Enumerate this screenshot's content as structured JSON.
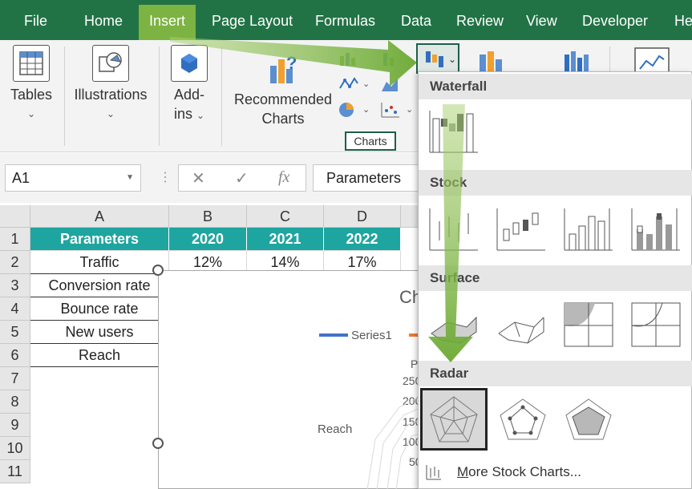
{
  "ribbon_tabs": [
    {
      "label": "File"
    },
    {
      "label": "Home"
    },
    {
      "label": "Insert",
      "active": true
    },
    {
      "label": "Page Layout"
    },
    {
      "label": "Formulas"
    },
    {
      "label": "Data"
    },
    {
      "label": "Review"
    },
    {
      "label": "View"
    },
    {
      "label": "Developer"
    },
    {
      "label": "Hel"
    }
  ],
  "ribbon": {
    "tables_label": "Tables",
    "illustrations_label": "Illustrations",
    "addins_line1": "Add-",
    "addins_line2": "ins",
    "recommended_line1": "Recommended",
    "recommended_line2": "Charts",
    "charts_group_label": "Charts"
  },
  "formula_bar": {
    "name_box": "A1",
    "cancel_glyph": "✕",
    "enter_glyph": "✓",
    "fx_glyph": "fx",
    "formula_value": "Parameters"
  },
  "grid": {
    "columns": [
      "A",
      "B",
      "C",
      "D"
    ],
    "rows": [
      "1",
      "2",
      "3",
      "4",
      "5",
      "6",
      "7",
      "8",
      "9",
      "10",
      "11"
    ],
    "header_row": [
      "Parameters",
      "2020",
      "2021",
      "2022"
    ],
    "data_rows": [
      [
        "Traffic",
        "12%",
        "14%",
        "17%"
      ],
      [
        "Conversion rate",
        "",
        "",
        ""
      ],
      [
        "Bounce rate",
        "",
        "",
        ""
      ],
      [
        "New users",
        "",
        "",
        ""
      ],
      [
        "Reach",
        "",
        "",
        ""
      ]
    ]
  },
  "embedded_chart": {
    "title_fragment": "Ch",
    "legend_series": "Series1",
    "axis_label_fragment": "P",
    "axis_ticks": [
      "250",
      "200",
      "150",
      "100",
      "50"
    ],
    "category_label": "Reach"
  },
  "dropdown": {
    "sections": [
      {
        "title": "Waterfall"
      },
      {
        "title": "Stock"
      },
      {
        "title": "Surface"
      },
      {
        "title": "Radar"
      }
    ],
    "more_link_prefix": "M",
    "more_link_rest": "ore Stock Charts..."
  },
  "colors": {
    "tab_bar": "#217346",
    "active_tab": "#7cb342",
    "table_header": "#1fa5a0",
    "arrow": "#7cb342"
  }
}
